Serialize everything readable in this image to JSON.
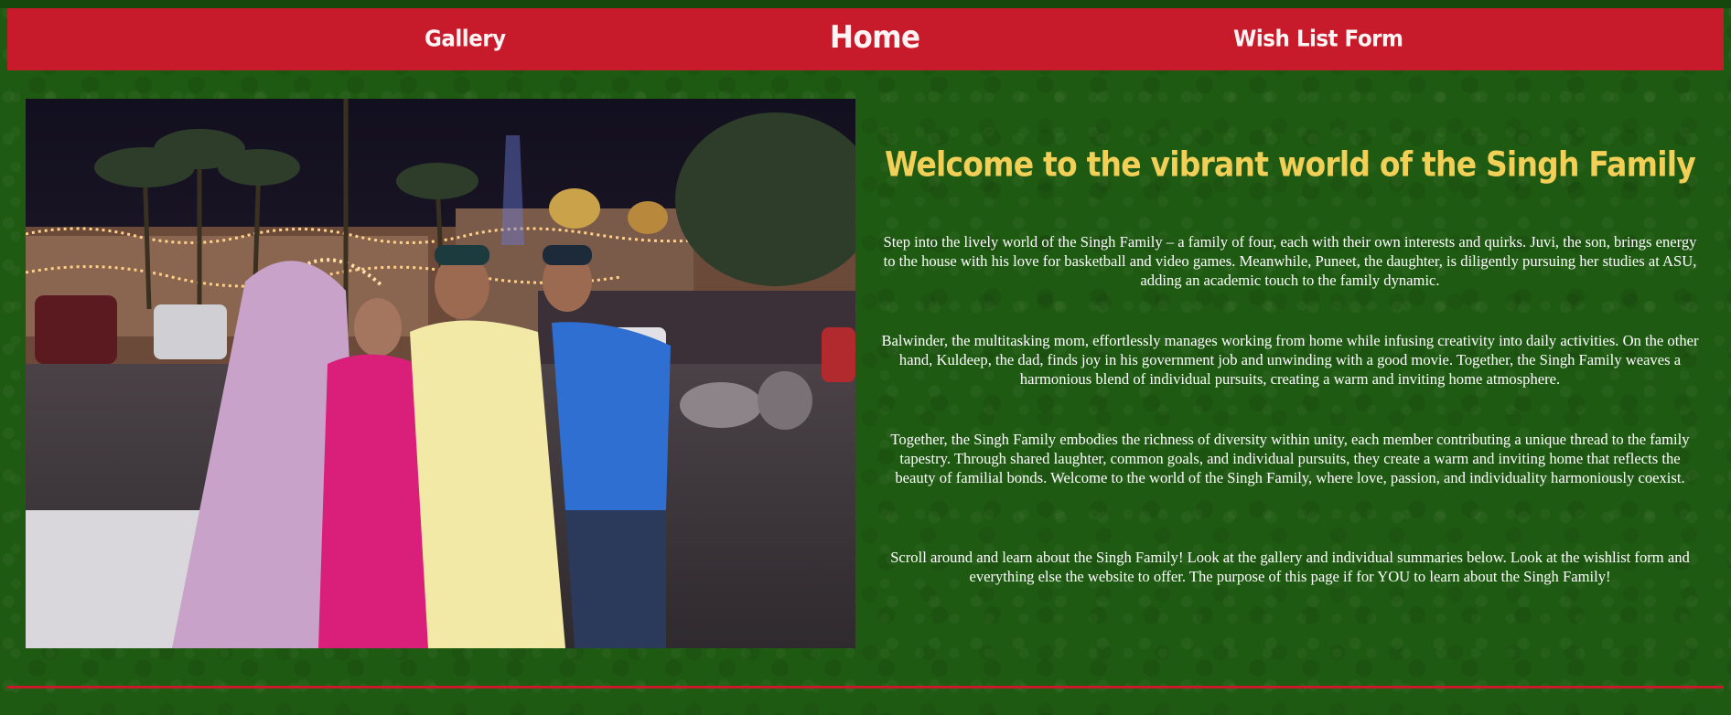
{
  "nav": {
    "links": [
      {
        "label": "Gallery"
      },
      {
        "label": "Home"
      },
      {
        "label": "Wish List Form"
      }
    ]
  },
  "colors": {
    "background": "#1f5a12",
    "nav_bar": "#c71a2a",
    "heading": "#f2cf57",
    "body_text": "#ffffff"
  },
  "hero": {
    "title": "Welcome to the vibrant world of the Singh Family"
  },
  "paragraphs": [
    "Step into the lively world of the Singh Family – a family of four, each with their own interests and quirks. Juvi, the son, brings energy to the house with his love for basketball and video games. Meanwhile, Puneet, the daughter, is diligently pursuing her studies at ASU, adding an academic touch to the family dynamic.",
    "Balwinder, the multitasking mom, effortlessly manages working from home while infusing creativity into daily activities. On the other hand, Kuldeep, the dad, finds joy in his government job and unwinding with a good movie. Together, the Singh Family weaves a harmonious blend of individual pursuits, creating a warm and inviting home atmosphere.",
    "Together, the Singh Family embodies the richness of diversity within unity, each member contributing a unique thread to the family tapestry. Through shared laughter, common goals, and individual pursuits, they create a warm and inviting home that reflects the beauty of familial bonds. Welcome to the world of the Singh Family, where love, passion, and individuality harmoniously coexist.",
    "Scroll around and learn about the Singh Family! Look at the gallery and individual summaries below. Look at the wishlist form and everything else the website to offer. The purpose of this page if for YOU to learn about the Singh Family!"
  ]
}
